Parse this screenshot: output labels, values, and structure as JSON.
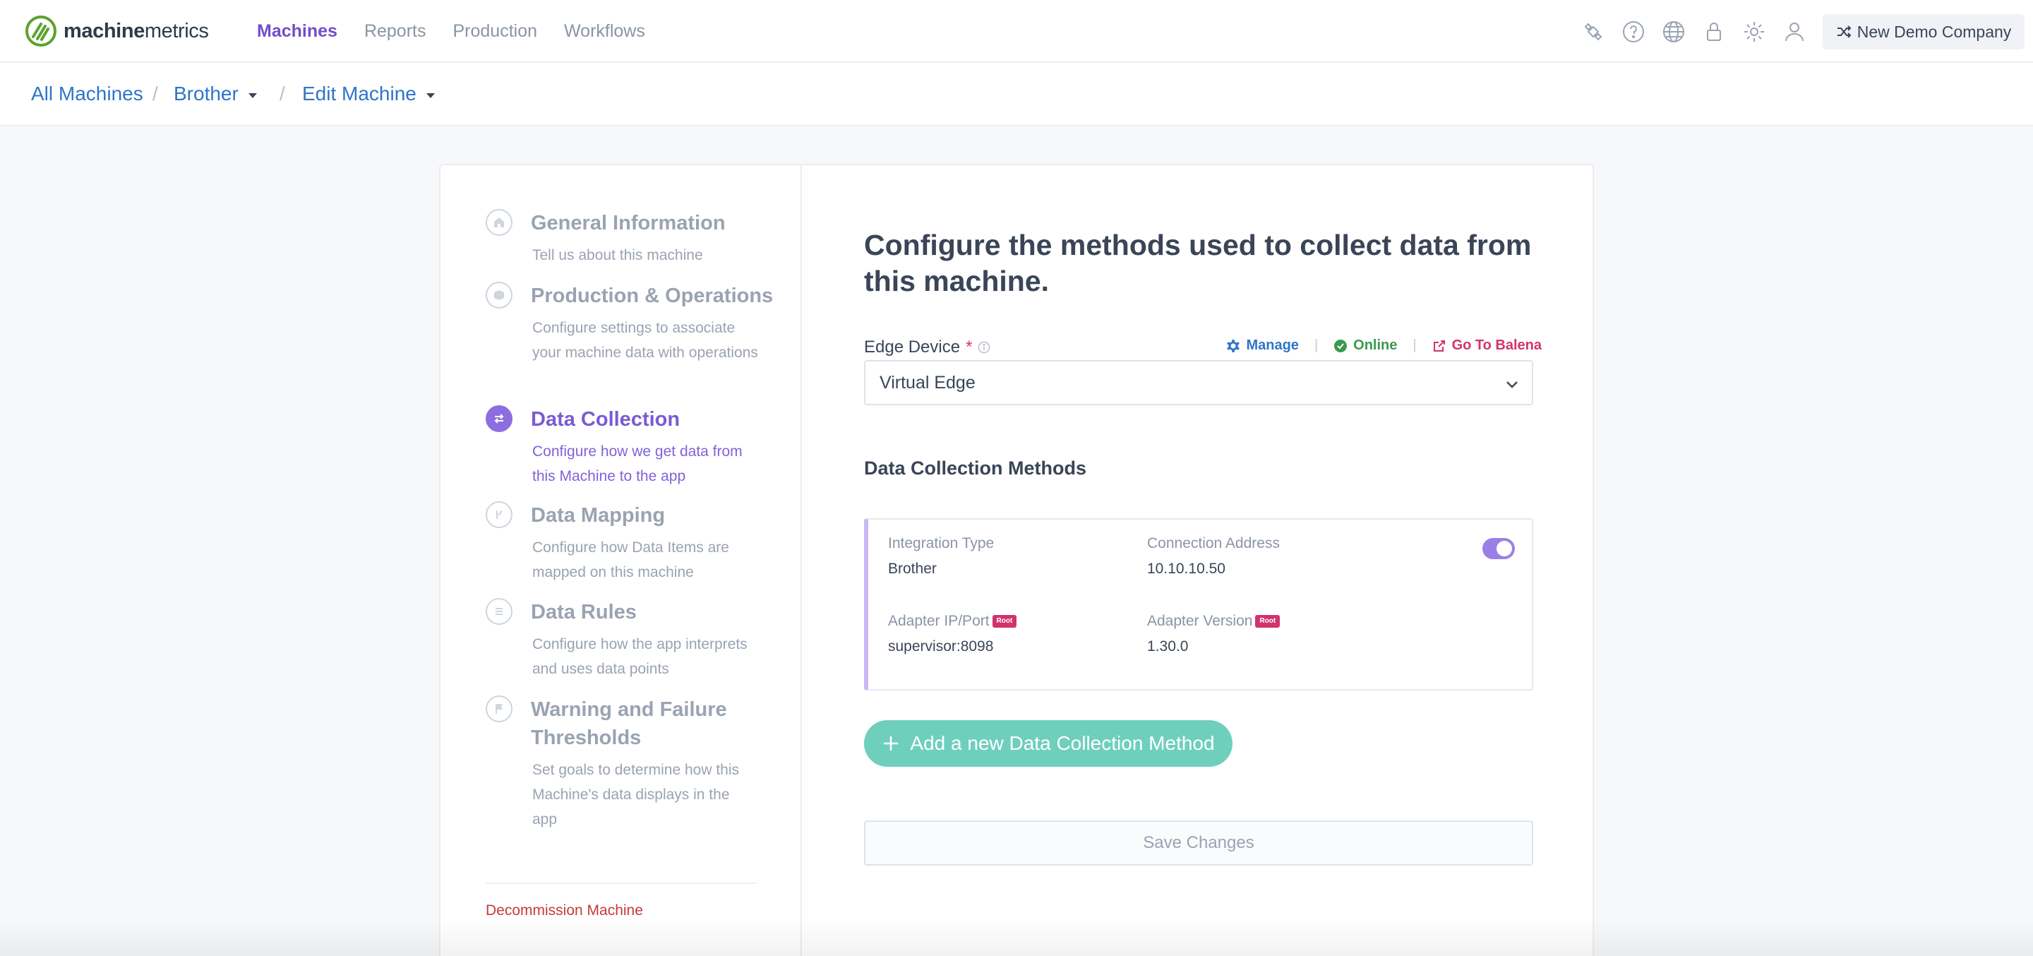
{
  "app": {
    "logo_bold": "machine",
    "logo_light": "metrics",
    "brand_color": "#5aa32b",
    "accent_color": "#7a5bd3"
  },
  "nav": {
    "links": [
      "Machines",
      "Reports",
      "Production",
      "Workflows"
    ],
    "active": "Machines",
    "icons": [
      "satellite-icon",
      "help-icon",
      "globe-icon",
      "lock-icon",
      "gear-icon",
      "user-icon"
    ],
    "company": "New Demo Company"
  },
  "breadcrumb": {
    "items": [
      "All Machines",
      "Brother",
      "Edit Machine"
    ],
    "separator": "/"
  },
  "steps": [
    {
      "title": "General Information",
      "desc": "Tell us about this machine",
      "icon": "home-icon"
    },
    {
      "title": "Production & Operations",
      "desc": "Configure settings to associate your machine data with operations",
      "icon": "box-icon"
    },
    {
      "title": "Data Collection",
      "desc": "Configure how we get data from this Machine to the app",
      "icon": "exchange-icon",
      "active": true
    },
    {
      "title": "Data Mapping",
      "desc": "Configure how Data Items are mapped on this machine",
      "icon": "mapping-icon"
    },
    {
      "title": "Data Rules",
      "desc": "Configure how the app interprets and uses data points",
      "icon": "list-icon"
    },
    {
      "title": "Warning and Failure Thresholds",
      "desc": "Set goals to determine how this Machine's data displays in the app",
      "icon": "flag-icon"
    }
  ],
  "decommission": "Decommission Machine",
  "main": {
    "title": "Configure the methods used to collect data from this machine.",
    "edge_device": {
      "label": "Edge Device",
      "required_mark": "*",
      "manage": "Manage",
      "status": "Online",
      "go_to": "Go To Balena",
      "value": "Virtual Edge"
    },
    "methods_title": "Data Collection Methods",
    "method": {
      "integration_type_label": "Integration Type",
      "integration_type": "Brother",
      "connection_address_label": "Connection Address",
      "connection_address": "10.10.10.50",
      "adapter_ip_label": "Adapter IP/Port",
      "adapter_ip": "supervisor:8098",
      "adapter_version_label": "Adapter Version",
      "adapter_version": "1.30.0",
      "badge": "Root",
      "enabled": true
    },
    "add_button": "Add a new Data Collection Method",
    "save_button": "Save Changes"
  }
}
